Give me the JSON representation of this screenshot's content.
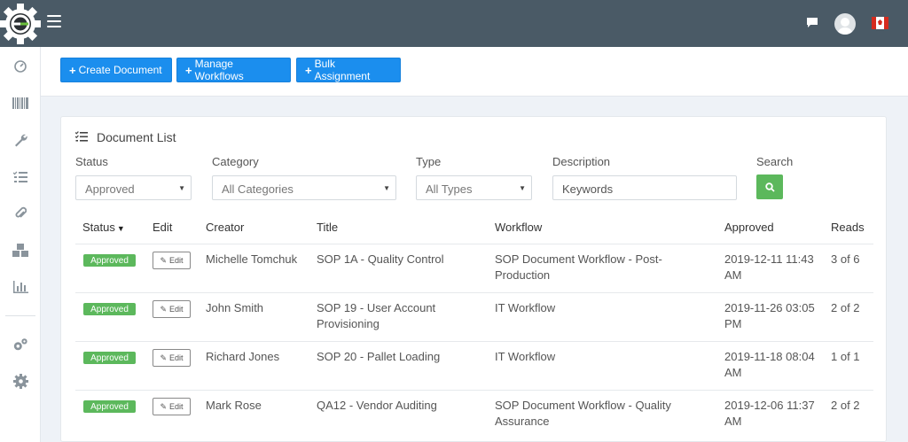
{
  "colors": {
    "topbar": "#4a5a66",
    "primary": "#1b8eee",
    "success": "#5cb85c",
    "sidebar_icon": "#8a949c"
  },
  "topbar": {
    "icons": [
      "logo-gear-icon",
      "hamburger-menu-icon",
      "chat-icon",
      "avatar",
      "canada-flag-icon"
    ]
  },
  "sidebar": {
    "icons": [
      "dashboard-icon",
      "barcode-icon",
      "wrench-icon",
      "checklist-icon",
      "paperclip-icon",
      "boxes-icon",
      "bar-chart-icon",
      "settings-cogs-icon",
      "gear-icon"
    ]
  },
  "actions": {
    "create": "Create Document",
    "manage": "Manage Workflows",
    "bulk": "Bulk Assignment"
  },
  "card": {
    "title": "Document List"
  },
  "filters": {
    "status_label": "Status",
    "status_value": "Approved",
    "category_label": "Category",
    "category_value": "All Categories",
    "type_label": "Type",
    "type_value": "All Types",
    "description_label": "Description",
    "description_placeholder": "Keywords",
    "search_label": "Search"
  },
  "table": {
    "headers": {
      "status": "Status",
      "edit": "Edit",
      "creator": "Creator",
      "title": "Title",
      "workflow": "Workflow",
      "approved": "Approved",
      "reads": "Reads"
    },
    "rows": [
      {
        "status": "Approved",
        "edit": "Edit",
        "creator": "Michelle Tomchuk",
        "title": "SOP 1A - Quality Control",
        "workflow": "SOP Document Workflow - Post-Production",
        "approved": "2019-12-11 11:43 AM",
        "reads": "3 of 6"
      },
      {
        "status": "Approved",
        "edit": "Edit",
        "creator": "John Smith",
        "title": "SOP 19 - User Account Provisioning",
        "workflow": "IT Workflow",
        "approved": "2019-11-26 03:05 PM",
        "reads": "2 of 2"
      },
      {
        "status": "Approved",
        "edit": "Edit",
        "creator": "Richard Jones",
        "title": "SOP 20 - Pallet Loading",
        "workflow": "IT Workflow",
        "approved": "2019-11-18 08:04 AM",
        "reads": "1 of 1"
      },
      {
        "status": "Approved",
        "edit": "Edit",
        "creator": "Mark Rose",
        "title": "QA12 - Vendor Auditing",
        "workflow": "SOP Document Workflow - Quality Assurance",
        "approved": "2019-12-06 11:37 AM",
        "reads": "2 of 2"
      }
    ]
  }
}
